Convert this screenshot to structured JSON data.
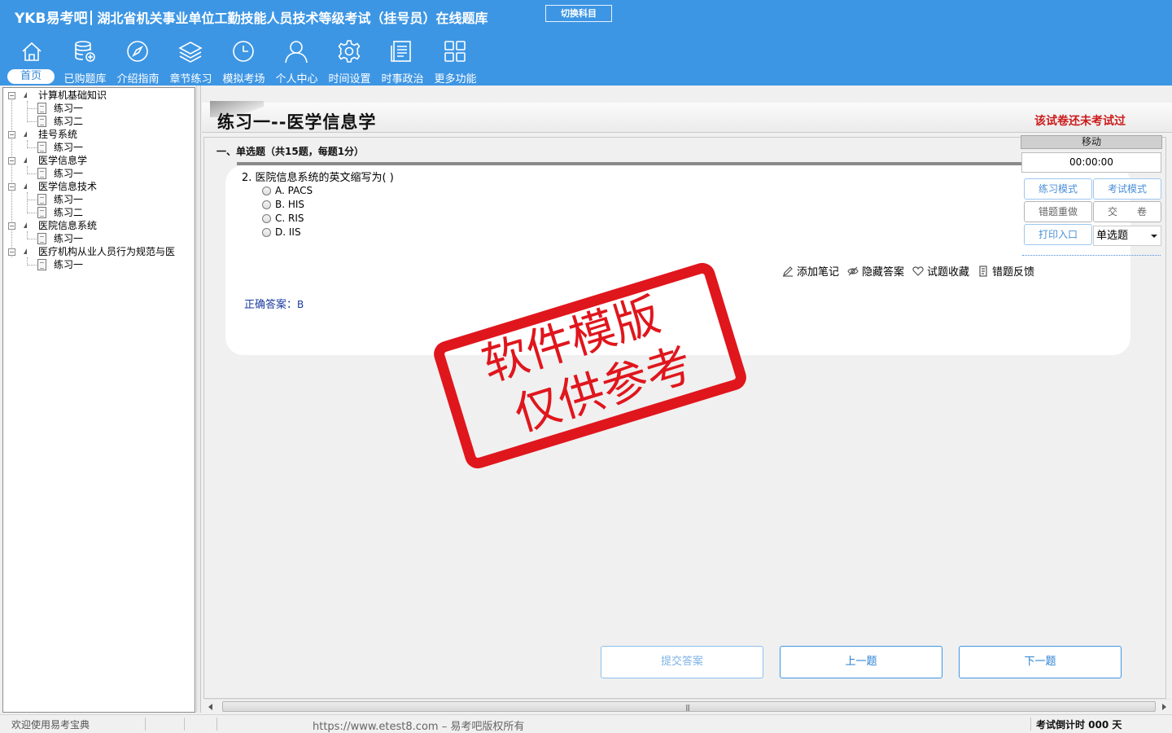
{
  "app": {
    "logo": "YKB易考吧",
    "title": "湖北省机关事业单位工勤技能人员技术等级考试（挂号员）在线题库",
    "switch_subject": "切换科目"
  },
  "nav": [
    {
      "label": "首页",
      "icon": "home-icon"
    },
    {
      "label": "已购题库",
      "icon": "database-icon"
    },
    {
      "label": "介绍指南",
      "icon": "compass-icon"
    },
    {
      "label": "章节练习",
      "icon": "layers-icon"
    },
    {
      "label": "模拟考场",
      "icon": "clock-icon"
    },
    {
      "label": "个人中心",
      "icon": "user-icon"
    },
    {
      "label": "时间设置",
      "icon": "gear-icon"
    },
    {
      "label": "时事政治",
      "icon": "news-icon"
    },
    {
      "label": "更多功能",
      "icon": "grid-icon"
    }
  ],
  "tree": [
    {
      "label": "计算机基础知识",
      "children": [
        "练习一",
        "练习二"
      ]
    },
    {
      "label": "挂号系统",
      "children": [
        "练习一"
      ]
    },
    {
      "label": "医学信息学",
      "children": [
        "练习一"
      ]
    },
    {
      "label": "医学信息技术",
      "children": [
        "练习一",
        "练习二"
      ]
    },
    {
      "label": "医院信息系统",
      "children": [
        "练习一"
      ]
    },
    {
      "label": "医疗机构从业人员行为规范与医",
      "children": [
        "练习一"
      ]
    }
  ],
  "paper": {
    "title": "练习一--医学信息学",
    "status": "该试卷还未考试过",
    "section": "一、单选题（共15题，每题1分）"
  },
  "question": {
    "text": "2. 医院信息系统的英文缩写为( )",
    "options": [
      "A. PACS",
      "B. HIS",
      "C. RIS",
      "D. IIS"
    ],
    "answer_label": "正确答案：",
    "answer_value": "B",
    "actions": [
      {
        "label": "添加笔记",
        "icon": "pencil-icon"
      },
      {
        "label": "隐藏答案",
        "icon": "eye-slash-icon"
      },
      {
        "label": "试题收藏",
        "icon": "heart-icon"
      },
      {
        "label": "错题反馈",
        "icon": "feedback-icon"
      }
    ]
  },
  "panel": {
    "move": "移动",
    "timer": "00:00:00",
    "practice_mode": "练习模式",
    "exam_mode": "考试模式",
    "redo_wrong": "错题重做",
    "submit_paper": "交　　卷",
    "print_entry": "打印入口",
    "question_type": "单选题"
  },
  "buttons": {
    "submit": "提交答案",
    "prev": "上一题",
    "next": "下一题"
  },
  "stamp": {
    "line1": "软件模版",
    "line2": "仅供参考"
  },
  "status": {
    "welcome": "欢迎使用易考宝典",
    "copyright": "https://www.etest8.com – 易考吧版权所有",
    "countdown": "考试倒计时 000 天"
  },
  "colors": {
    "header_bg": "#3d96e4",
    "status_red": "#cc1b1b",
    "answer_blue": "#1a3aa0",
    "stamp_red": "#e0161d"
  }
}
